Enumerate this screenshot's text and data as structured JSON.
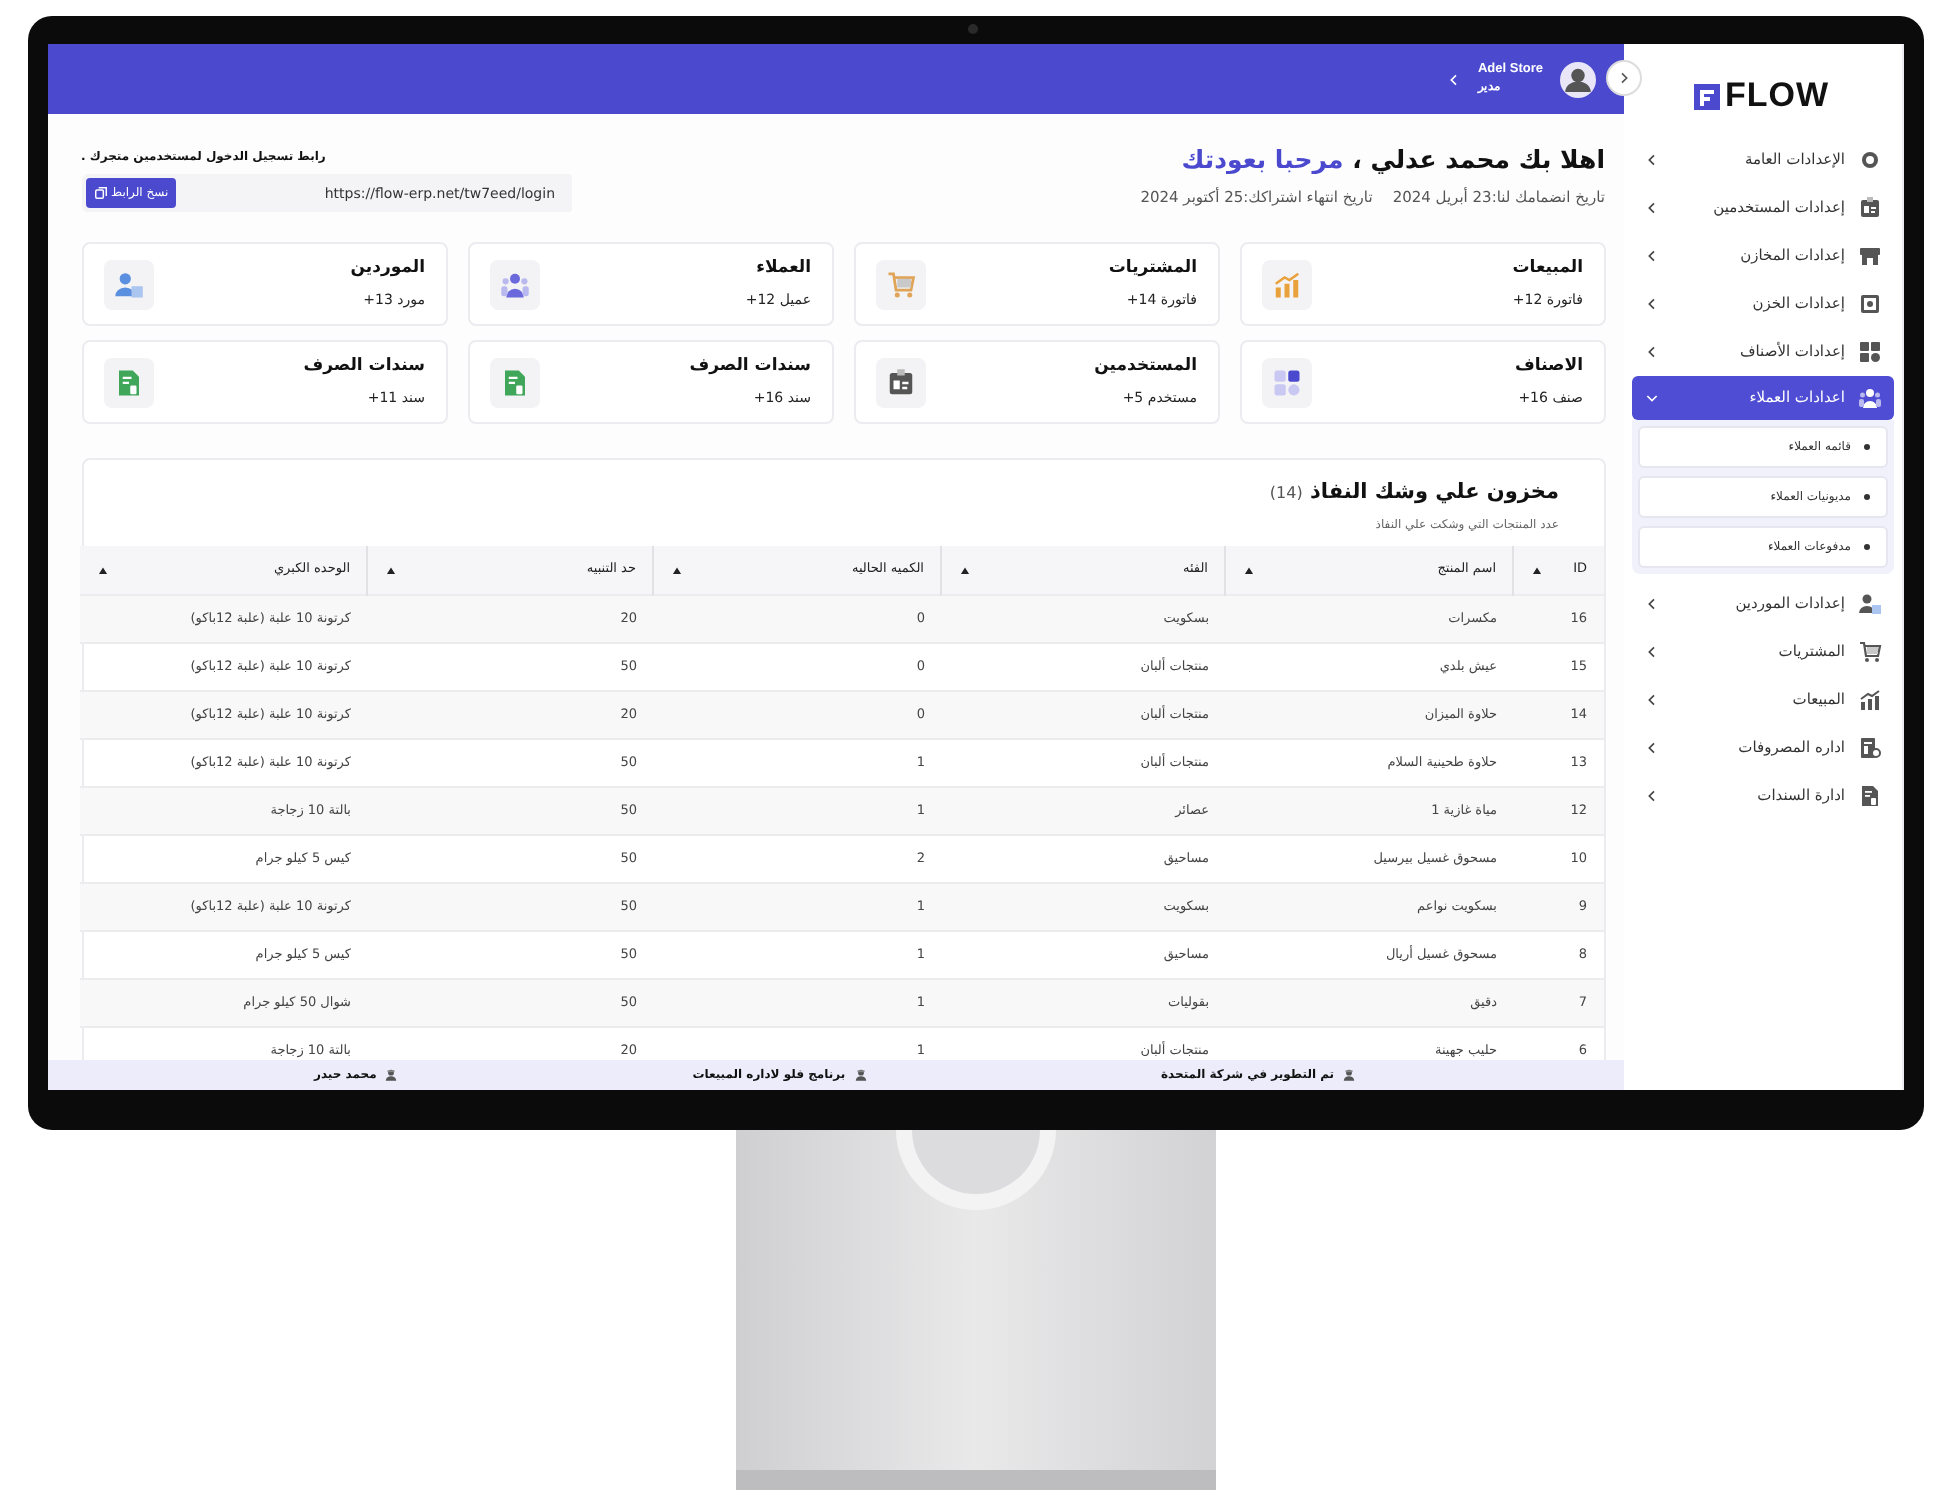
{
  "sidebar": {
    "logo": "FLOW",
    "items": [
      {
        "label": "الإعدادات العامة",
        "selected": false,
        "expanded": false
      },
      {
        "label": "إعدادات المستخدمين",
        "selected": false,
        "expanded": false
      },
      {
        "label": "إعدادات المخازن",
        "selected": false,
        "expanded": false
      },
      {
        "label": "إعدادات الخزن",
        "selected": false,
        "expanded": false
      },
      {
        "label": "إعدادات الأصناف",
        "selected": false,
        "expanded": false
      },
      {
        "label": "اعدادات العملاء",
        "selected": true,
        "expanded": true,
        "children": [
          {
            "label": "قائمه العملاء"
          },
          {
            "label": "مديونيات العملاء"
          },
          {
            "label": "مدفوعات العملاء"
          }
        ]
      },
      {
        "label": "إعدادات الموردين",
        "selected": false,
        "expanded": false
      },
      {
        "label": "المشتريات",
        "selected": false,
        "expanded": false
      },
      {
        "label": "المبيعات",
        "selected": false,
        "expanded": false
      },
      {
        "label": "اداره المصروفات",
        "selected": false,
        "expanded": false
      },
      {
        "label": "ادارة السندات",
        "selected": false,
        "expanded": false
      }
    ]
  },
  "header": {
    "user_name": "Adel Store",
    "user_role": "مدير"
  },
  "welcome": {
    "greeting": "اهلا بك محمد عدلي ،",
    "highlight": "مرحبا بعودتك",
    "join_date": "تاريخ انضمامك لنا:23 أبريل 2024",
    "expiry_date": "تاريخ انتهاء اشتراكك:25 أكتوبر 2024"
  },
  "login_link": {
    "label": "رابط تسجيل الدخول لمستخدمين متجرك .",
    "url": "https://flow-erp.net/tw7eed/login",
    "copy_button": "نسخ الرابط"
  },
  "stats": [
    {
      "title": "المبيعات",
      "count": "+12 فاتورة"
    },
    {
      "title": "المشتريات",
      "count": "+14 فاتورة"
    },
    {
      "title": "العملاء",
      "count": "+12 عميل"
    },
    {
      "title": "الموردين",
      "count": "+13 مورد"
    },
    {
      "title": "الاصناف",
      "count": "+16 صنف"
    },
    {
      "title": "المستخدمين",
      "count": "+5 مستخدم"
    },
    {
      "title": "سندات الصرف",
      "count": "+16 سند"
    },
    {
      "title": "سندات الصرف",
      "count": "+11 سند"
    }
  ],
  "low_stock": {
    "title": "مخزون علي وشك النفاذ",
    "count": "(14)",
    "subtitle": "عدد المنتجات التي وشكت علي النفاذ",
    "columns": [
      "ID",
      "اسم المنتج",
      "الفئه",
      "الكميه الحاليه",
      "حد التنبيه",
      "الوحده الكبري"
    ],
    "rows": [
      [
        "16",
        "مكسرات",
        "بسكويت",
        "0",
        "20",
        "كرتونة 10 علبة (علبة 12باكو)"
      ],
      [
        "15",
        "عيش بلدي",
        "منتجات ألبان",
        "0",
        "50",
        "كرتونة 10 علبة (علبة 12باكو)"
      ],
      [
        "14",
        "حلاوة الميزان",
        "منتجات ألبان",
        "0",
        "20",
        "كرتونة 10 علبة (علبة 12باكو)"
      ],
      [
        "13",
        "حلاوة طحينية السلام",
        "منتجات ألبان",
        "1",
        "50",
        "كرتونة 10 علبة (علبة 12باكو)"
      ],
      [
        "12",
        "مياة غازية 1",
        "عصائر",
        "1",
        "50",
        "بالتة 10 زجاجة"
      ],
      [
        "10",
        "مسحوق غسيل بيرسيل",
        "مساحيق",
        "2",
        "50",
        "كيس 5 كيلو جرام"
      ],
      [
        "9",
        "بسكويت نواعم",
        "بسكويت",
        "1",
        "50",
        "كرتونة 10 علبة (علبة 12باكو)"
      ],
      [
        "8",
        "مسحوق غسيل أريال",
        "مساحيق",
        "1",
        "50",
        "كيس 5 كيلو جرام"
      ],
      [
        "7",
        "دقيق",
        "بقوليات",
        "1",
        "50",
        "شوال 50 كيلو جرام"
      ],
      [
        "6",
        "حليب جهينة",
        "منتجات ألبان",
        "1",
        "20",
        "بالتة 10 زجاجة"
      ]
    ]
  },
  "footer": [
    "تم التطوير في شركة المتحدة",
    "برنامج فلو لاداره المبيعات",
    "محمد حيدر"
  ]
}
